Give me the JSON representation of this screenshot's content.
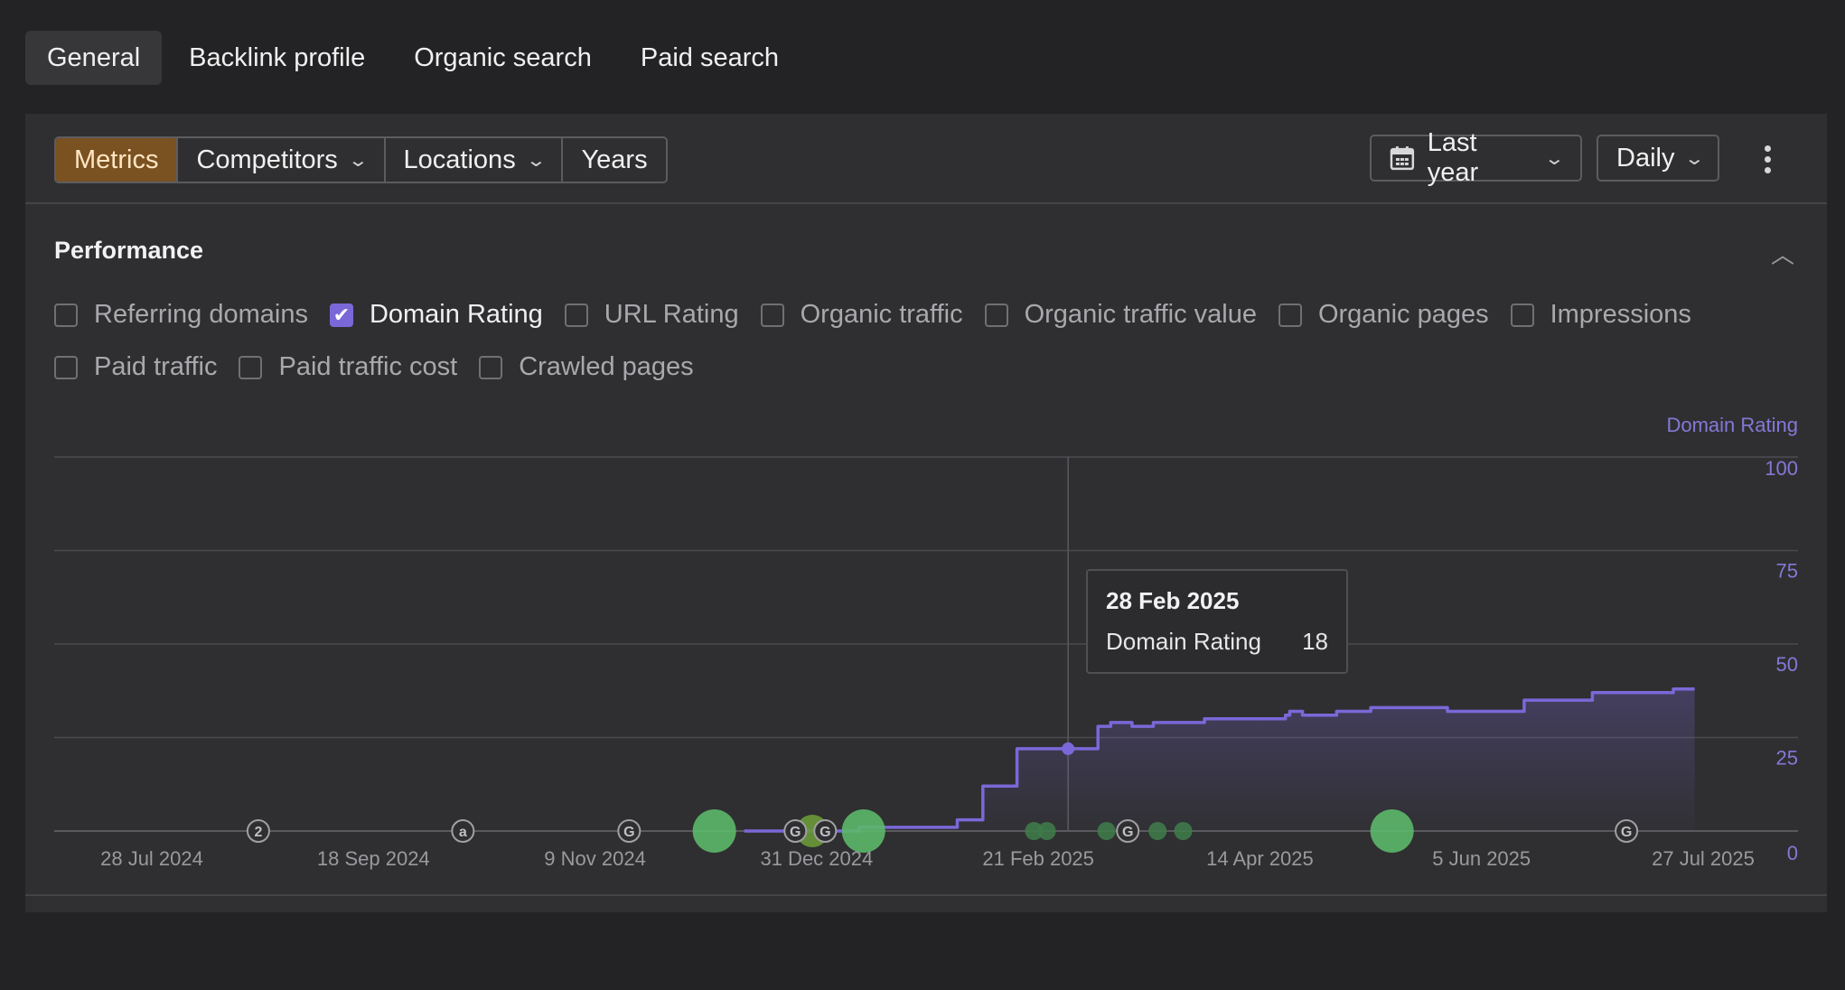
{
  "tabs": [
    {
      "label": "General",
      "active": true
    },
    {
      "label": "Backlink profile"
    },
    {
      "label": "Organic search"
    },
    {
      "label": "Paid search"
    }
  ],
  "toolbar": {
    "metrics": "Metrics",
    "competitors": "Competitors",
    "locations": "Locations",
    "years": "Years",
    "period": "Last year",
    "granularity": "Daily"
  },
  "performance": {
    "title": "Performance",
    "metrics_row1": [
      {
        "label": "Referring domains",
        "checked": false
      },
      {
        "label": "Domain Rating",
        "checked": true
      },
      {
        "label": "URL Rating",
        "checked": false
      },
      {
        "label": "Organic traffic",
        "checked": false
      },
      {
        "label": "Organic traffic value",
        "checked": false
      },
      {
        "label": "Organic pages",
        "checked": false
      },
      {
        "label": "Impressions",
        "checked": false
      }
    ],
    "metrics_row2": [
      {
        "label": "Paid traffic",
        "checked": false
      },
      {
        "label": "Paid traffic cost",
        "checked": false
      },
      {
        "label": "Crawled pages",
        "checked": false
      }
    ]
  },
  "chart_data": {
    "type": "area",
    "series": [
      {
        "name": "Domain Rating",
        "color": "#7b68d8",
        "x": [
          "2024-07-28",
          "2024-12-14",
          "2025-01-10",
          "2025-01-31",
          "2025-02-02",
          "2025-02-08",
          "2025-02-14",
          "2025-02-16",
          "2025-02-28",
          "2025-03-07",
          "2025-03-10",
          "2025-03-15",
          "2025-03-20",
          "2025-04-01",
          "2025-04-20",
          "2025-04-21",
          "2025-04-24",
          "2025-05-02",
          "2025-05-10",
          "2025-05-28",
          "2025-06-01",
          "2025-06-15",
          "2025-06-20",
          "2025-07-01",
          "2025-07-08",
          "2025-07-20",
          "2025-07-25"
        ],
        "values": [
          0,
          0,
          1,
          1,
          3,
          12,
          12,
          22,
          22,
          28,
          29,
          28,
          29,
          30,
          31,
          32,
          31,
          32,
          33,
          32,
          32,
          35,
          35,
          37,
          37,
          38,
          38
        ]
      }
    ],
    "xticks": [
      "28 Jul 2024",
      "18 Sep 2024",
      "9 Nov 2024",
      "31 Dec 2024",
      "21 Feb 2025",
      "14 Apr 2025",
      "5 Jun 2025",
      "27 Jul 2025"
    ],
    "yticks": [
      0,
      25,
      50,
      75,
      100
    ],
    "ylim": [
      0,
      100
    ],
    "legend": "Domain Rating",
    "legend_position": "top-right",
    "grid": true,
    "markers": [
      {
        "x": "2024-08-22",
        "icon": "2"
      },
      {
        "x": "2024-10-09",
        "icon": "a"
      },
      {
        "x": "2024-11-17",
        "icon": "G"
      },
      {
        "x": "2024-12-26",
        "icon": "G"
      },
      {
        "x": "2025-01-02",
        "icon": "G"
      },
      {
        "x": "2025-03-14",
        "icon": "G"
      },
      {
        "x": "2025-07-09",
        "icon": "G"
      }
    ],
    "events": [
      {
        "x": "2024-12-07",
        "size": "large",
        "color": "#5cb86a"
      },
      {
        "x": "2024-12-30",
        "size": "medium",
        "color": "#6a9a3a"
      },
      {
        "x": "2025-01-11",
        "size": "large",
        "color": "#5cb86a"
      },
      {
        "x": "2025-02-20",
        "size": "small",
        "color": "#3f7a4a"
      },
      {
        "x": "2025-02-23",
        "size": "small",
        "color": "#3f7a4a"
      },
      {
        "x": "2025-03-09",
        "size": "small",
        "color": "#3f7a4a"
      },
      {
        "x": "2025-03-21",
        "size": "small",
        "color": "#3f7a4a"
      },
      {
        "x": "2025-03-27",
        "size": "small",
        "color": "#3f7a4a"
      },
      {
        "x": "2025-05-15",
        "size": "large",
        "color": "#5cb86a"
      }
    ],
    "tooltip": {
      "date": "28 Feb 2025",
      "label": "Domain Rating",
      "value": "18",
      "x": "2025-02-28",
      "y": 22
    }
  }
}
